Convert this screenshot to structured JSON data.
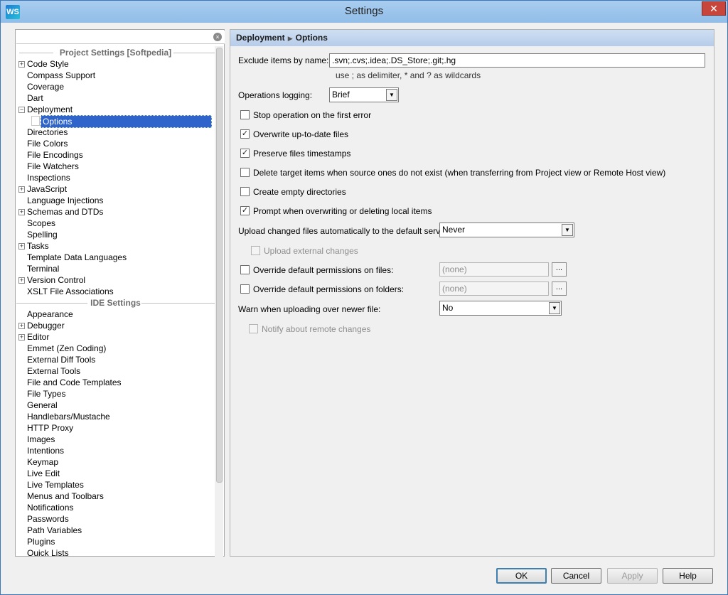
{
  "window": {
    "title": "Settings",
    "logo": "WS",
    "close_label": "✕"
  },
  "search": {
    "value": "",
    "clear_icon": "×"
  },
  "tree": {
    "project_header": "Project Settings [Softpedia]",
    "ide_header": "IDE Settings",
    "project_items": [
      {
        "label": "Code Style",
        "expander": "+"
      },
      {
        "label": "Compass Support",
        "expander": ""
      },
      {
        "label": "Coverage",
        "expander": ""
      },
      {
        "label": "Dart",
        "expander": ""
      },
      {
        "label": "Deployment",
        "expander": "−"
      },
      {
        "label": "Options",
        "expander": "",
        "selected": true
      },
      {
        "label": "Directories",
        "expander": ""
      },
      {
        "label": "File Colors",
        "expander": ""
      },
      {
        "label": "File Encodings",
        "expander": ""
      },
      {
        "label": "File Watchers",
        "expander": ""
      },
      {
        "label": "Inspections",
        "expander": ""
      },
      {
        "label": "JavaScript",
        "expander": "+"
      },
      {
        "label": "Language Injections",
        "expander": ""
      },
      {
        "label": "Schemas and DTDs",
        "expander": "+"
      },
      {
        "label": "Scopes",
        "expander": ""
      },
      {
        "label": "Spelling",
        "expander": ""
      },
      {
        "label": "Tasks",
        "expander": "+"
      },
      {
        "label": "Template Data Languages",
        "expander": ""
      },
      {
        "label": "Terminal",
        "expander": ""
      },
      {
        "label": "Version Control",
        "expander": "+"
      },
      {
        "label": "XSLT File Associations",
        "expander": ""
      }
    ],
    "ide_items": [
      {
        "label": "Appearance",
        "expander": ""
      },
      {
        "label": "Debugger",
        "expander": "+"
      },
      {
        "label": "Editor",
        "expander": "+"
      },
      {
        "label": "Emmet (Zen Coding)",
        "expander": ""
      },
      {
        "label": "External Diff Tools",
        "expander": ""
      },
      {
        "label": "External Tools",
        "expander": ""
      },
      {
        "label": "File and Code Templates",
        "expander": ""
      },
      {
        "label": "File Types",
        "expander": ""
      },
      {
        "label": "General",
        "expander": ""
      },
      {
        "label": "Handlebars/Mustache",
        "expander": ""
      },
      {
        "label": "HTTP Proxy",
        "expander": ""
      },
      {
        "label": "Images",
        "expander": ""
      },
      {
        "label": "Intentions",
        "expander": ""
      },
      {
        "label": "Keymap",
        "expander": ""
      },
      {
        "label": "Live Edit",
        "expander": ""
      },
      {
        "label": "Live Templates",
        "expander": ""
      },
      {
        "label": "Menus and Toolbars",
        "expander": ""
      },
      {
        "label": "Notifications",
        "expander": ""
      },
      {
        "label": "Passwords",
        "expander": ""
      },
      {
        "label": "Path Variables",
        "expander": ""
      },
      {
        "label": "Plugins",
        "expander": ""
      },
      {
        "label": "Quick Lists",
        "expander": ""
      }
    ]
  },
  "breadcrumb": {
    "parent": "Deployment",
    "separator": "▶",
    "current": "Options"
  },
  "form": {
    "exclude_label": "Exclude items by name:",
    "exclude_value": ".svn;.cvs;.idea;.DS_Store;.git;.hg",
    "exclude_hint": "use ; as delimiter, * and ? as wildcards",
    "logging_label": "Operations logging:",
    "logging_value": "Brief",
    "stop_on_error": {
      "label": "Stop operation on the first error",
      "checked": ""
    },
    "overwrite_uptodate": {
      "label": "Overwrite up-to-date files",
      "checked": "✓"
    },
    "preserve_timestamps": {
      "label": "Preserve files timestamps",
      "checked": "✓"
    },
    "delete_target": {
      "label": "Delete target items when source ones do not exist (when transferring from Project view or Remote Host view)",
      "checked": ""
    },
    "create_empty_dirs": {
      "label": "Create empty directories",
      "checked": ""
    },
    "prompt_overwrite": {
      "label": "Prompt when overwriting or deleting local items",
      "checked": "✓"
    },
    "upload_auto_label": "Upload changed files automatically to the default server",
    "upload_auto_value": "Never",
    "upload_external": {
      "label": "Upload external changes",
      "checked": ""
    },
    "override_files": {
      "label": "Override default permissions on files:",
      "checked": "",
      "value": "(none)"
    },
    "override_folders": {
      "label": "Override default permissions on folders:",
      "checked": "",
      "value": "(none)"
    },
    "warn_newer_label": "Warn when uploading over newer file:",
    "warn_newer_value": "No",
    "notify_remote": {
      "label": "Notify about remote changes",
      "checked": ""
    },
    "dropdown_arrow": "▼",
    "ellipsis": "..."
  },
  "buttons": {
    "ok": "OK",
    "cancel": "Cancel",
    "apply": "Apply",
    "help": "Help"
  }
}
